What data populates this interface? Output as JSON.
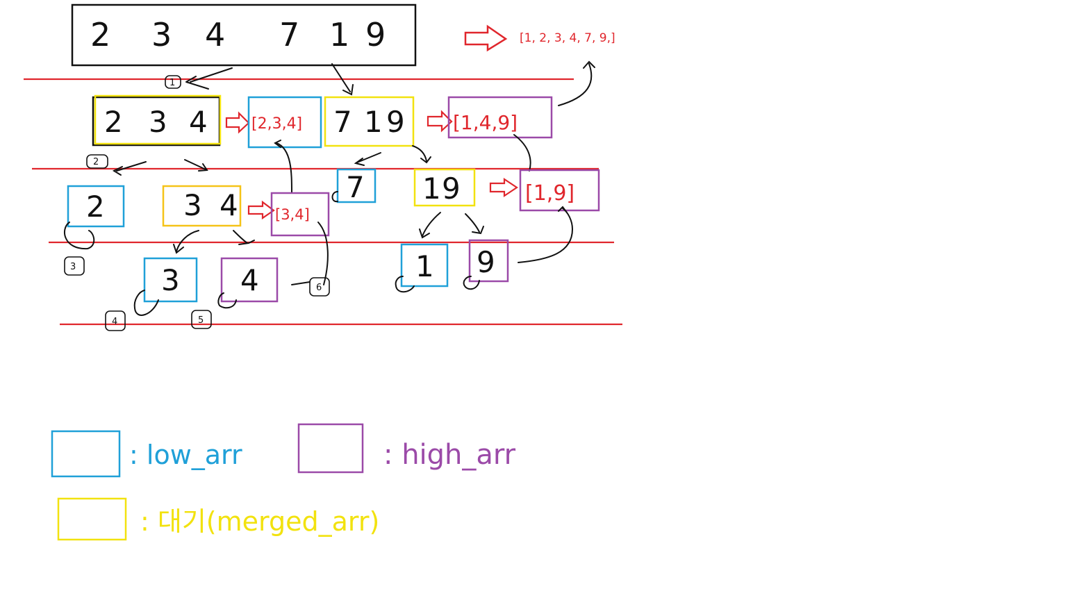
{
  "colors": {
    "low": "#1fa0d8",
    "high": "#9b4aa8",
    "merged": "#f2e20f",
    "red": "#e0262c",
    "black": "#111111"
  },
  "top": {
    "values": [
      "2",
      "3",
      "4",
      "7",
      "1",
      "9"
    ],
    "result": "[1, 2, 3, 4, 7, 9,]"
  },
  "level1": {
    "left": [
      "2",
      "3",
      "4"
    ],
    "left_merged": "[2,3,4]",
    "right": [
      "7",
      "1",
      "9"
    ],
    "right_merged": "[1,4,9]"
  },
  "level2": {
    "a": "2",
    "b": [
      "3",
      "4"
    ],
    "b_merged": "[3,4]",
    "c": "7",
    "d": [
      "1",
      "9"
    ],
    "d_merged": "[1,9]"
  },
  "level3": {
    "a": "3",
    "b": "4",
    "c": "1",
    "d": "9"
  },
  "steps": [
    "1",
    "2",
    "3",
    "4",
    "5",
    "6"
  ],
  "legend": {
    "low": ": low_arr",
    "high": ": high_arr",
    "merged": ": 대기(merged_arr)"
  },
  "icons": {
    "arrow": "red-hollow-arrow-icon",
    "step": "step-number-icon"
  }
}
